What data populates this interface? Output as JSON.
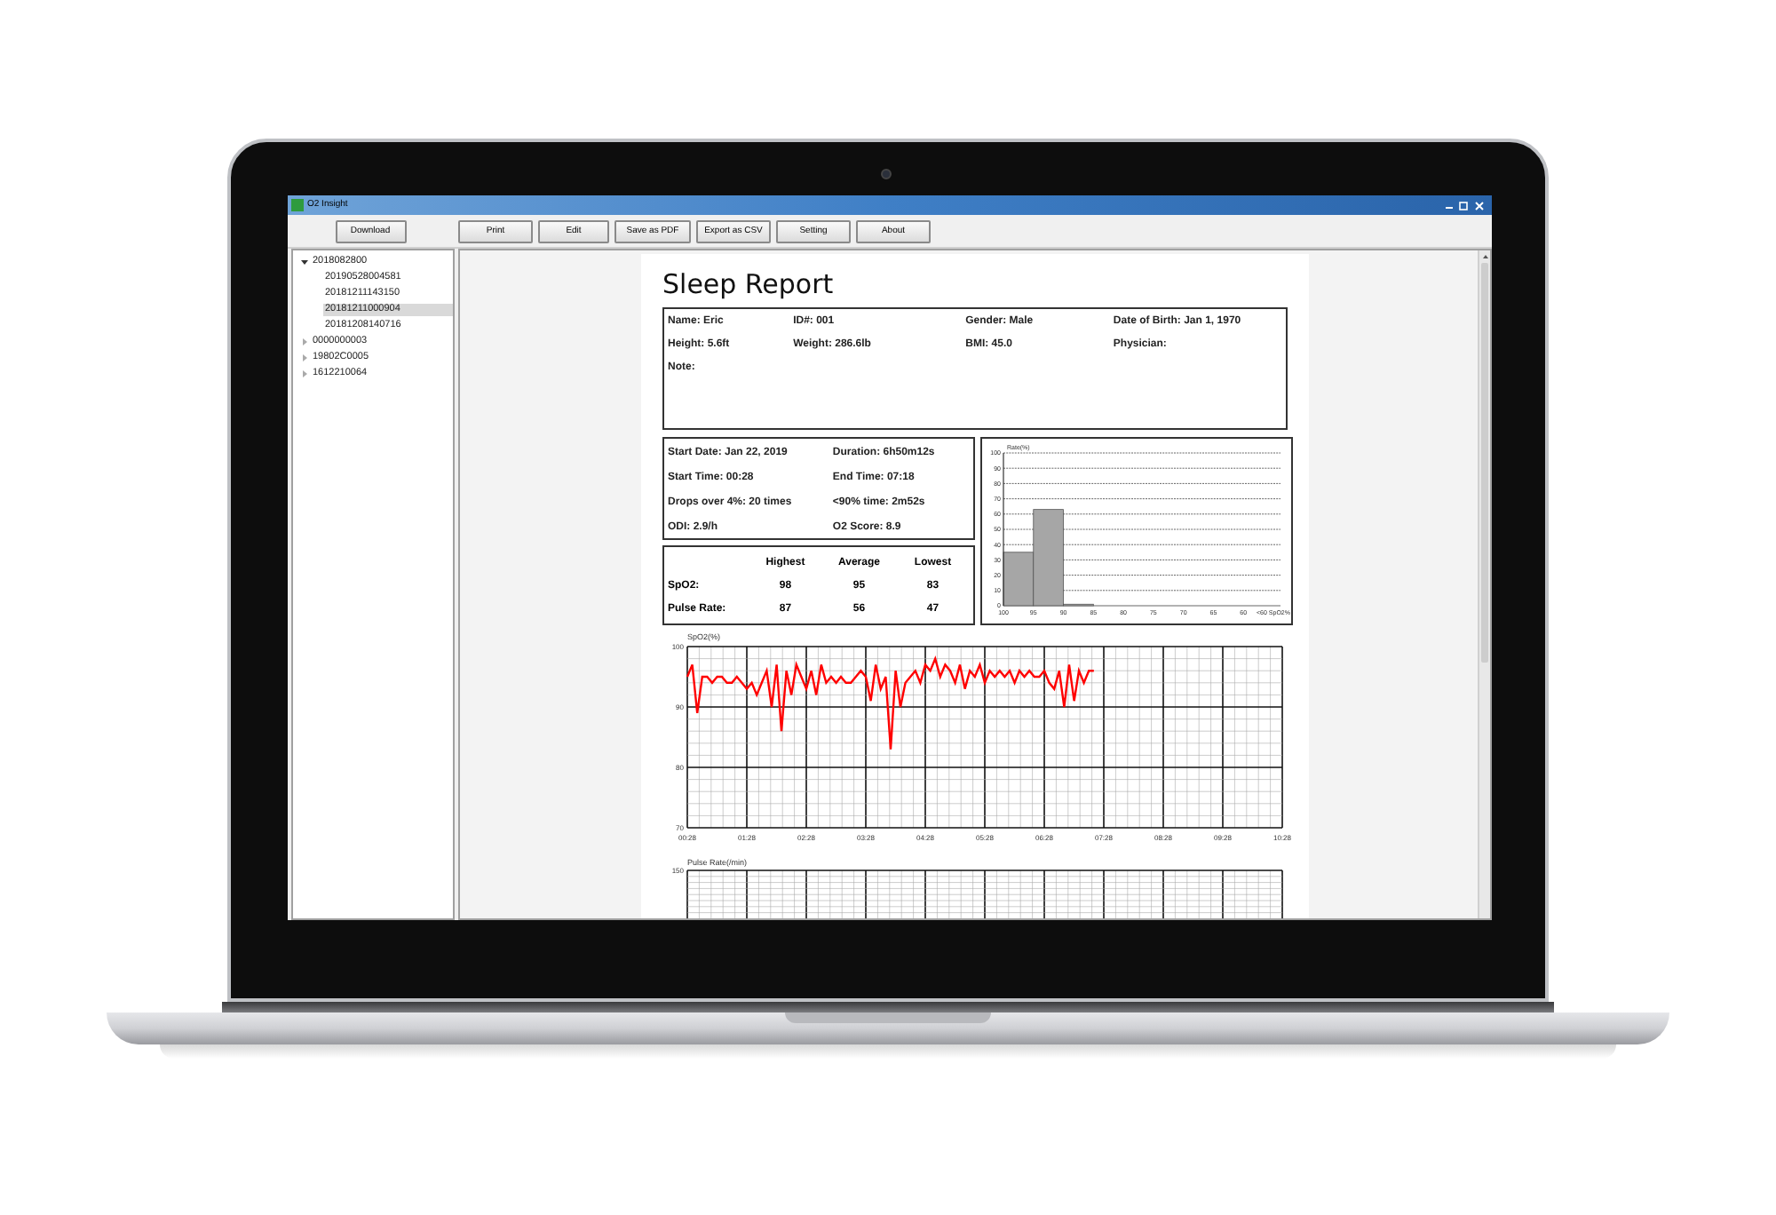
{
  "window": {
    "title": "O2 Insight"
  },
  "left_toolbar": {
    "button": "Download"
  },
  "toolbar": [
    "Print",
    "Edit",
    "Save as PDF",
    "Export as CSV",
    "Setting",
    "About"
  ],
  "tree": [
    {
      "label": "2018082800",
      "expanded": true,
      "selected": false,
      "children": [
        {
          "label": "20190528004581",
          "selected": false
        },
        {
          "label": "20181211143150",
          "selected": false
        },
        {
          "label": "20181211000904",
          "selected": true
        },
        {
          "label": "20181208140716",
          "selected": false
        }
      ]
    },
    {
      "label": "0000000003",
      "expanded": false,
      "selected": false
    },
    {
      "label": "19802C0005",
      "expanded": false,
      "selected": false
    },
    {
      "label": "1612210064",
      "expanded": false,
      "selected": false
    }
  ],
  "report": {
    "title": "Sleep Report",
    "patient_info": [
      [
        "Name: Eric",
        "ID#: 001",
        "Gender: Male",
        "Date of Birth: Jan 1, 1970"
      ],
      [
        "Height: 5.6ft",
        "Weight: 286.6lb",
        "BMI: 45.0",
        "Physician:"
      ],
      [
        "Note:"
      ]
    ],
    "summary": [
      [
        "Start Date: Jan 22, 2019",
        "Duration: 6h50m12s"
      ],
      [
        "Start Time: 00:28",
        "End Time: 07:18"
      ],
      [
        "Drops over 4%: 20 times",
        "<90% time: 2m52s"
      ],
      [
        "ODI: 2.9/h",
        "O2 Score: 8.9"
      ]
    ],
    "stats_table": {
      "columns": [
        "Highest",
        "Average",
        "Lowest"
      ],
      "rows": [
        {
          "label": "SpO2:",
          "values": [
            "98",
            "95",
            "83"
          ]
        },
        {
          "label": "Pulse Rate:",
          "values": [
            "87",
            "56",
            "47"
          ]
        }
      ]
    },
    "histogram": {
      "chart_data": {
        "type": "bar",
        "title": "Rate(%)",
        "categories": [
          "100",
          "95",
          "90",
          "85",
          "80",
          "75",
          "70",
          "65",
          "60",
          "<60 SpO2%"
        ],
        "grid": true,
        "series": [
          {
            "color": "#a6a6a6",
            "values": [
              35,
              63,
              1,
              0,
              0,
              0,
              0,
              0,
              0,
              null
            ]
          }
        ],
        "ylim": [
          0,
          100
        ],
        "yticks": [
          0,
          10,
          20,
          30,
          40,
          50,
          60,
          70,
          80,
          90,
          100
        ]
      }
    },
    "spo2_chart": {
      "chart_data": {
        "type": "line",
        "ylabel": "SpO2(%)",
        "x": [
          28,
          33,
          38,
          43,
          48,
          53,
          58,
          63,
          68,
          73,
          78,
          83,
          88,
          93,
          98,
          103,
          108,
          113,
          118,
          123,
          128,
          133,
          138,
          143,
          148,
          153,
          158,
          163,
          168,
          173,
          178,
          183,
          188,
          193,
          198,
          203,
          208,
          213,
          218,
          223,
          228,
          233,
          238,
          243,
          248,
          253,
          258,
          263,
          268,
          273,
          278,
          283,
          288,
          293,
          298,
          303,
          308,
          313,
          318,
          323,
          328,
          333,
          338,
          343,
          348,
          353,
          358,
          363,
          368,
          373,
          378,
          383,
          388,
          393,
          398,
          403,
          408,
          413,
          418,
          423,
          428,
          433,
          438
        ],
        "grid": true,
        "series": [
          {
            "color": "#ff0000",
            "values": [
              95,
              97,
              89,
              95,
              95,
              94,
              95,
              95,
              94,
              94,
              95,
              94,
              93,
              94,
              92,
              94,
              96,
              90,
              97,
              86,
              96,
              92,
              97,
              95,
              93,
              96,
              92,
              97,
              94,
              95,
              94,
              95,
              94,
              94,
              95,
              96,
              95,
              91,
              97,
              93,
              95,
              83,
              96,
              90,
              94,
              95,
              96,
              94,
              97,
              96,
              98,
              95,
              97,
              96,
              94,
              97,
              93,
              96,
              95,
              97,
              94,
              96,
              95,
              96,
              95,
              96,
              94,
              96,
              95,
              96,
              95,
              95,
              96,
              94,
              93,
              96,
              90,
              97,
              91,
              96,
              94,
              96,
              96
            ]
          }
        ],
        "xlim": [
          28,
          628
        ],
        "ylim": [
          70,
          100
        ],
        "yticks": [
          70,
          80,
          90,
          100
        ],
        "xticks": [
          {
            "value": 28,
            "label": "00:28"
          },
          {
            "value": 88,
            "label": "01:28"
          },
          {
            "value": 148,
            "label": "02:28"
          },
          {
            "value": 208,
            "label": "03:28"
          },
          {
            "value": 268,
            "label": "04:28"
          },
          {
            "value": 328,
            "label": "05:28"
          },
          {
            "value": 388,
            "label": "06:28"
          },
          {
            "value": 448,
            "label": "07:28"
          },
          {
            "value": 508,
            "label": "08:28"
          },
          {
            "value": 568,
            "label": "09:28"
          },
          {
            "value": 628,
            "label": "10:28"
          }
        ]
      }
    },
    "pulse_chart": {
      "title": "Pulse Rate(/min)",
      "top_tick": "150"
    }
  }
}
